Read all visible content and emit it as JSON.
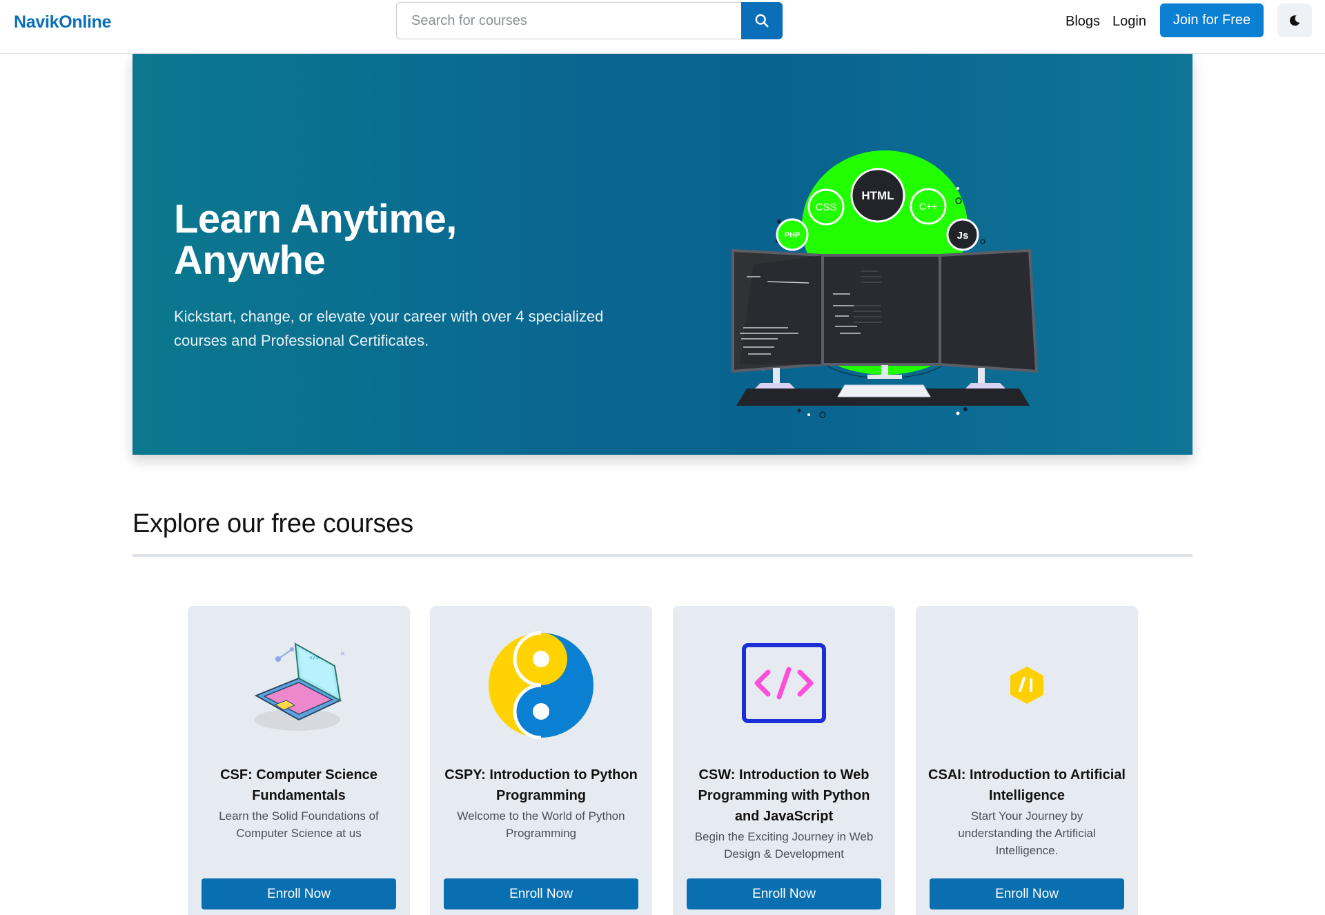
{
  "navbar": {
    "brand": "NavikOnline",
    "search": {
      "placeholder": "Search for courses",
      "value": ""
    },
    "links": {
      "blogs": "Blogs",
      "login": "Login"
    },
    "join_label": "Join for Free"
  },
  "hero": {
    "title_line1": "Learn Anytime,",
    "title_line2": "Anywhe",
    "subtitle": "Kickstart, change, or elevate your career with over 4 specialized courses and Professional Certificates.",
    "art_labels": {
      "html": "HTML",
      "css": "CSS",
      "cpp": "C++",
      "php": "PHP",
      "js": "Js"
    }
  },
  "section": {
    "title": "Explore our free courses"
  },
  "courses": [
    {
      "title": "CSF: Computer Science Fundamentals",
      "description": "Learn the Solid Foundations of Computer Science at us",
      "button": "Enroll Now",
      "icon": "laptop-icon"
    },
    {
      "title": "CSPY: Introduction to Python Programming",
      "description": "Welcome to the World of Python Programming",
      "button": "Enroll Now",
      "icon": "python-icon"
    },
    {
      "title": "CSW: Introduction to Web Programming with Python and JavaScript",
      "description": "Begin the Exciting Journey in Web Design & Development",
      "button": "Enroll Now",
      "icon": "code-icon"
    },
    {
      "title": "CSAI: Introduction to Artificial Intelligence",
      "description": "Start Your Journey by understanding the Artificial Intelligence.",
      "button": "Enroll Now",
      "icon": "ai-icon"
    }
  ],
  "colors": {
    "brand": "#0a6fb8",
    "hero": "#0a6490",
    "button": "#0a6fb0",
    "card_bg": "#e6ebf2"
  }
}
